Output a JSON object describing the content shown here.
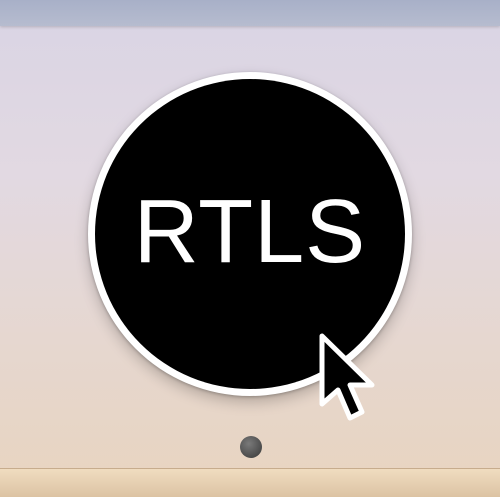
{
  "app_icon": {
    "label": "RTLS",
    "background_color": "#000000",
    "ring_color": "#ffffff",
    "text_color": "#ffffff"
  },
  "dock": {
    "running_indicator_color": "#4b4b4b"
  },
  "cursor": {
    "icon": "arrow-pointer-icon"
  }
}
